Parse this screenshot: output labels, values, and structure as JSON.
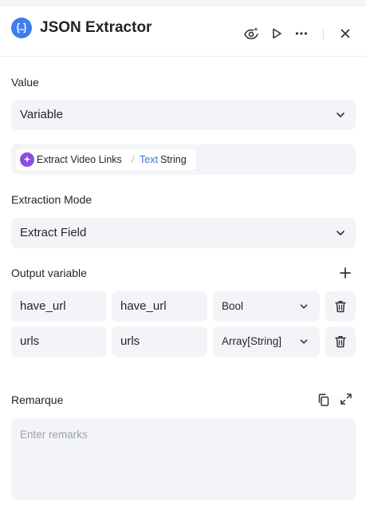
{
  "header": {
    "title": "JSON Extractor",
    "icons": [
      "json-braces-icon",
      "eye-sparkle-icon",
      "play-icon",
      "more-icon",
      "close-icon"
    ]
  },
  "value_field": {
    "label": "Value",
    "selected": "Variable"
  },
  "variable_ref": {
    "node": "Extract Video Links",
    "separator": "/",
    "name": "Text",
    "type": "String"
  },
  "extraction_mode": {
    "label": "Extraction Mode",
    "selected": "Extract Field"
  },
  "output": {
    "label": "Output variable",
    "rows": [
      {
        "key": "have_url",
        "value": "have_url",
        "type": "Bool"
      },
      {
        "key": "urls",
        "value": "urls",
        "type": "Array[String]"
      }
    ]
  },
  "remarks": {
    "label": "Remarque",
    "placeholder": "Enter remarks",
    "value": ""
  },
  "colors": {
    "accent": "#3f7cf0",
    "node_icon": "#8a4ce6",
    "field_bg": "#f3f4f7",
    "link": "#3a72e6"
  }
}
